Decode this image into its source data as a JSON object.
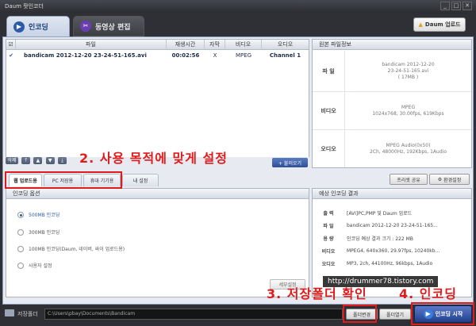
{
  "window": {
    "title": "Daum 팟인코더"
  },
  "tabs": [
    {
      "label": "인코딩",
      "active": true
    },
    {
      "label": "동영상 편집",
      "active": false
    }
  ],
  "upload_button": "Daum 업로드",
  "file_table": {
    "headers": [
      "파일",
      "재생시간",
      "자막",
      "비디오",
      "오디오"
    ],
    "rows": [
      {
        "checked": true,
        "file": "bandicam 2012-12-20 23-24-51-165.avi",
        "duration": "00:02:56",
        "subtitle": "X",
        "video": "MPEG",
        "audio": "Channel 1"
      }
    ],
    "add_button": "+ 불러오기"
  },
  "source_info": {
    "header": "원본 파일정보",
    "rows": [
      {
        "label": "파 일",
        "lines": [
          "bandicam 2012-12-20",
          "23-24-51-165.avi",
          "( 17MB )"
        ]
      },
      {
        "label": "비디오",
        "lines": [
          "MPEG",
          "1024x768, 30.00fps, 619Kbps"
        ]
      },
      {
        "label": "오디오",
        "lines": [
          "MPEG Audio(0x50)",
          "2Ch, 48000Hz, 192Kbps, 1Audio"
        ]
      }
    ]
  },
  "purpose_tabs": [
    {
      "label": "웹 업로드용",
      "active": true
    },
    {
      "label": "PC 저장용",
      "active": false
    },
    {
      "label": "휴대 기기용",
      "active": false
    },
    {
      "label": "내 설정",
      "active": false
    }
  ],
  "right_buttons": {
    "preset": "프리셋 공유",
    "settings": "환경설정"
  },
  "encoding_options": {
    "header": "인코딩 옵션",
    "options": [
      {
        "label": "500MB 인코딩",
        "selected": true
      },
      {
        "label": "300MB 인코딩",
        "selected": false
      },
      {
        "label": "100MB 인코딩(Daum, 네이버, 싸이 업로드용)",
        "selected": false
      },
      {
        "label": "사용자 설정",
        "selected": false
      }
    ],
    "advanced": "세부설정"
  },
  "result": {
    "header": "예상 인코딩 결과",
    "rows": [
      {
        "label": "출 력",
        "value": "[AVI]PC,PMP 및 Daum 업로드"
      },
      {
        "label": "파 일",
        "value": "bandicam 2012-12-20 23-24-51-165..."
      },
      {
        "label": "용 량",
        "value": "인코딩 예상 결과 크기 : 222 MB"
      },
      {
        "label": "비디오",
        "value": "MPEG4, 640x360, 29.97fps, 10240kb..."
      },
      {
        "label": "오디오",
        "value": "MP3, 2ch, 44100Hz, 96kbps, 1Audio"
      }
    ]
  },
  "bottom": {
    "folder_label": "저장폴더",
    "path": "C:\\Users\\pbay\\Documents\\Bandicam",
    "change_button": "폴더변경",
    "open_button": "폴더열기",
    "start_button": "인코딩 시작"
  },
  "annotations": {
    "step2": "2. 사용 목적에 맞게 설정",
    "step3": "3. 저장폴더 확인",
    "step4": "4. 인코딩"
  },
  "watermark": "http://drummer78.tistory.com",
  "colors": {
    "annotation": "#e01b1b",
    "accent": "#2d4f95"
  }
}
